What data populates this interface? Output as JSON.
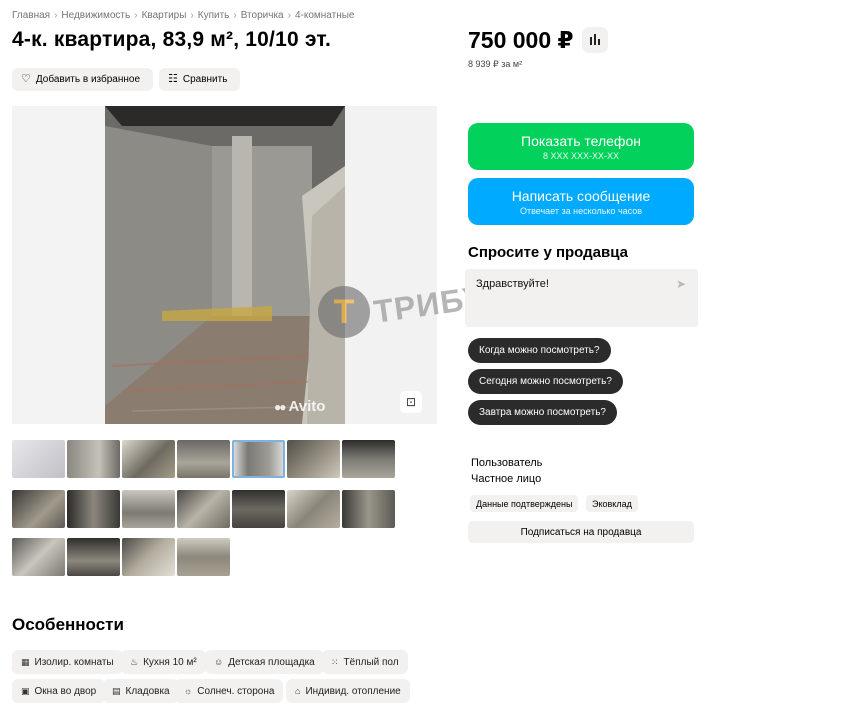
{
  "breadcrumb": [
    "Главная",
    "Недвижимость",
    "Квартиры",
    "Купить",
    "Вторичка",
    "4-комнатные"
  ],
  "breadcrumb_separator": "›",
  "title": "4-к. квартира, 83,9 м², 10/10 эт.",
  "actions": {
    "favorite_label": "Добавить в избранное",
    "favorite_icon": "heart-icon",
    "compare_label": "Сравнить",
    "compare_icon": "compare-icon"
  },
  "gallery": {
    "watermark_text": "ТРИБУН",
    "watermark_letter": "Т",
    "brand_text": "Avito",
    "thumbnail_count": 18,
    "active_thumbnail": 5
  },
  "price": {
    "value": "750 000 ₽",
    "per_meter": "8 939 ₽ за м²",
    "stats_icon": "bar-chart-icon"
  },
  "contacts": {
    "phone_label": "Показать телефон",
    "phone_mask": "8 XXX XXX-XX-XX",
    "phone_color": "#02d15c",
    "message_label": "Написать сообщение",
    "message_sub": "Отвечает за несколько часов",
    "message_color": "#00aaff"
  },
  "ask": {
    "title": "Спросите у продавца",
    "input_value": "Здравствуйте!",
    "send_icon": "send-icon",
    "quick_questions": [
      "Когда можно посмотреть?",
      "Сегодня можно посмотреть?",
      "Завтра можно посмотреть?"
    ]
  },
  "seller": {
    "name": "Пользователь",
    "type": "Частное лицо",
    "badges": [
      "Данные подтверждены",
      "Эковклад"
    ],
    "subscribe_label": "Подписаться на продавца"
  },
  "features": {
    "title": "Особенности",
    "items": [
      {
        "icon": "grid-icon",
        "glyph": "▦",
        "label": "Изолир. комнаты"
      },
      {
        "icon": "chef-hat-icon",
        "glyph": "♨",
        "label": "Кухня 10 м²"
      },
      {
        "icon": "playground-icon",
        "glyph": "☺",
        "label": "Детская площадка"
      },
      {
        "icon": "heated-floor-icon",
        "glyph": "⁙",
        "label": "Тёплый пол"
      },
      {
        "icon": "window-icon",
        "glyph": "▣",
        "label": "Окна во двор"
      },
      {
        "icon": "storage-icon",
        "glyph": "▤",
        "label": "Кладовка"
      },
      {
        "icon": "sun-icon",
        "glyph": "☼",
        "label": "Солнеч. сторона"
      },
      {
        "icon": "heating-icon",
        "glyph": "⌂",
        "label": "Индивид. отопление"
      }
    ]
  }
}
